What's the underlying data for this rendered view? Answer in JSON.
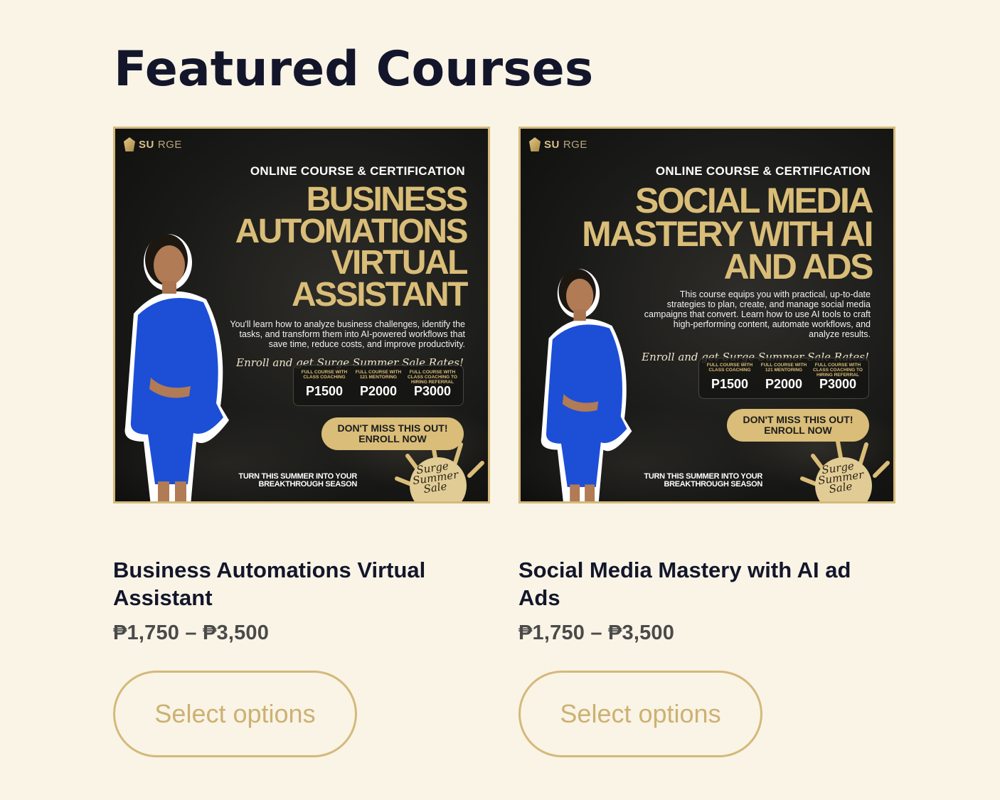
{
  "section": {
    "title": "Featured Courses"
  },
  "courses": [
    {
      "banner": {
        "logo_bold": "SU",
        "logo_light": "RGE",
        "kicker": "ONLINE COURSE & CERTIFICATION",
        "headline": "BUSINESS\nAUTOMATIONS\nVIRTUAL\nASSISTANT",
        "blurb": "You'll learn how to analyze business challenges, identify the tasks, and transform them into AI-powered workflows that save time, reduce costs, and improve productivity.",
        "script_line": "Enroll and get Surge Summer Sale Rates!",
        "tiers": [
          {
            "label": "FULL COURSE WITH CLASS COACHING",
            "price": "P1500"
          },
          {
            "label": "FULL COURSE WITH 121 MENTORING",
            "price": "P2000"
          },
          {
            "label": "FULL COURSE WITH CLASS COACHING TO HIRING REFERRAL",
            "price": "P3000"
          }
        ],
        "enroll": "DON'T MISS THIS OUT! ENROLL NOW",
        "tagline": "TURN THIS SUMMER INTO YOUR BREAKTHROUGH SEASON",
        "sun_text": "Surge Summer Sale"
      },
      "title": "Business Automations Virtual Assistant",
      "price": "₱1,750 – ₱3,500",
      "button": "Select options"
    },
    {
      "banner": {
        "logo_bold": "SU",
        "logo_light": "RGE",
        "kicker": "ONLINE COURSE & CERTIFICATION",
        "headline": "SOCIAL MEDIA\nMASTERY WITH AI\nAND ADS",
        "blurb": "This course equips you with practical, up-to-date strategies to plan, create, and manage social media campaigns that convert. Learn how to use AI tools to craft high-performing content, automate workflows, and analyze results.",
        "script_line": "Enroll and get Surge Summer Sale Rates!",
        "tiers": [
          {
            "label": "FULL COURSE WITH CLASS COACHING",
            "price": "P1500"
          },
          {
            "label": "FULL COURSE WITH 121 MENTORING",
            "price": "P2000"
          },
          {
            "label": "FULL COURSE WITH CLASS COACHING TO HIRING REFERRAL",
            "price": "P3000"
          }
        ],
        "enroll": "DON'T MISS THIS OUT! ENROLL NOW",
        "tagline": "TURN THIS SUMMER INTO YOUR BREAKTHROUGH SEASON",
        "sun_text": "Surge Summer Sale"
      },
      "title": "Social Media Mastery with AI ad Ads",
      "price": "₱1,750 – ₱3,500",
      "button": "Select options"
    }
  ],
  "colors": {
    "background": "#f9f4e6",
    "heading": "#13162b",
    "gold": "#d4b97a",
    "dress": "#1d4fd6"
  }
}
